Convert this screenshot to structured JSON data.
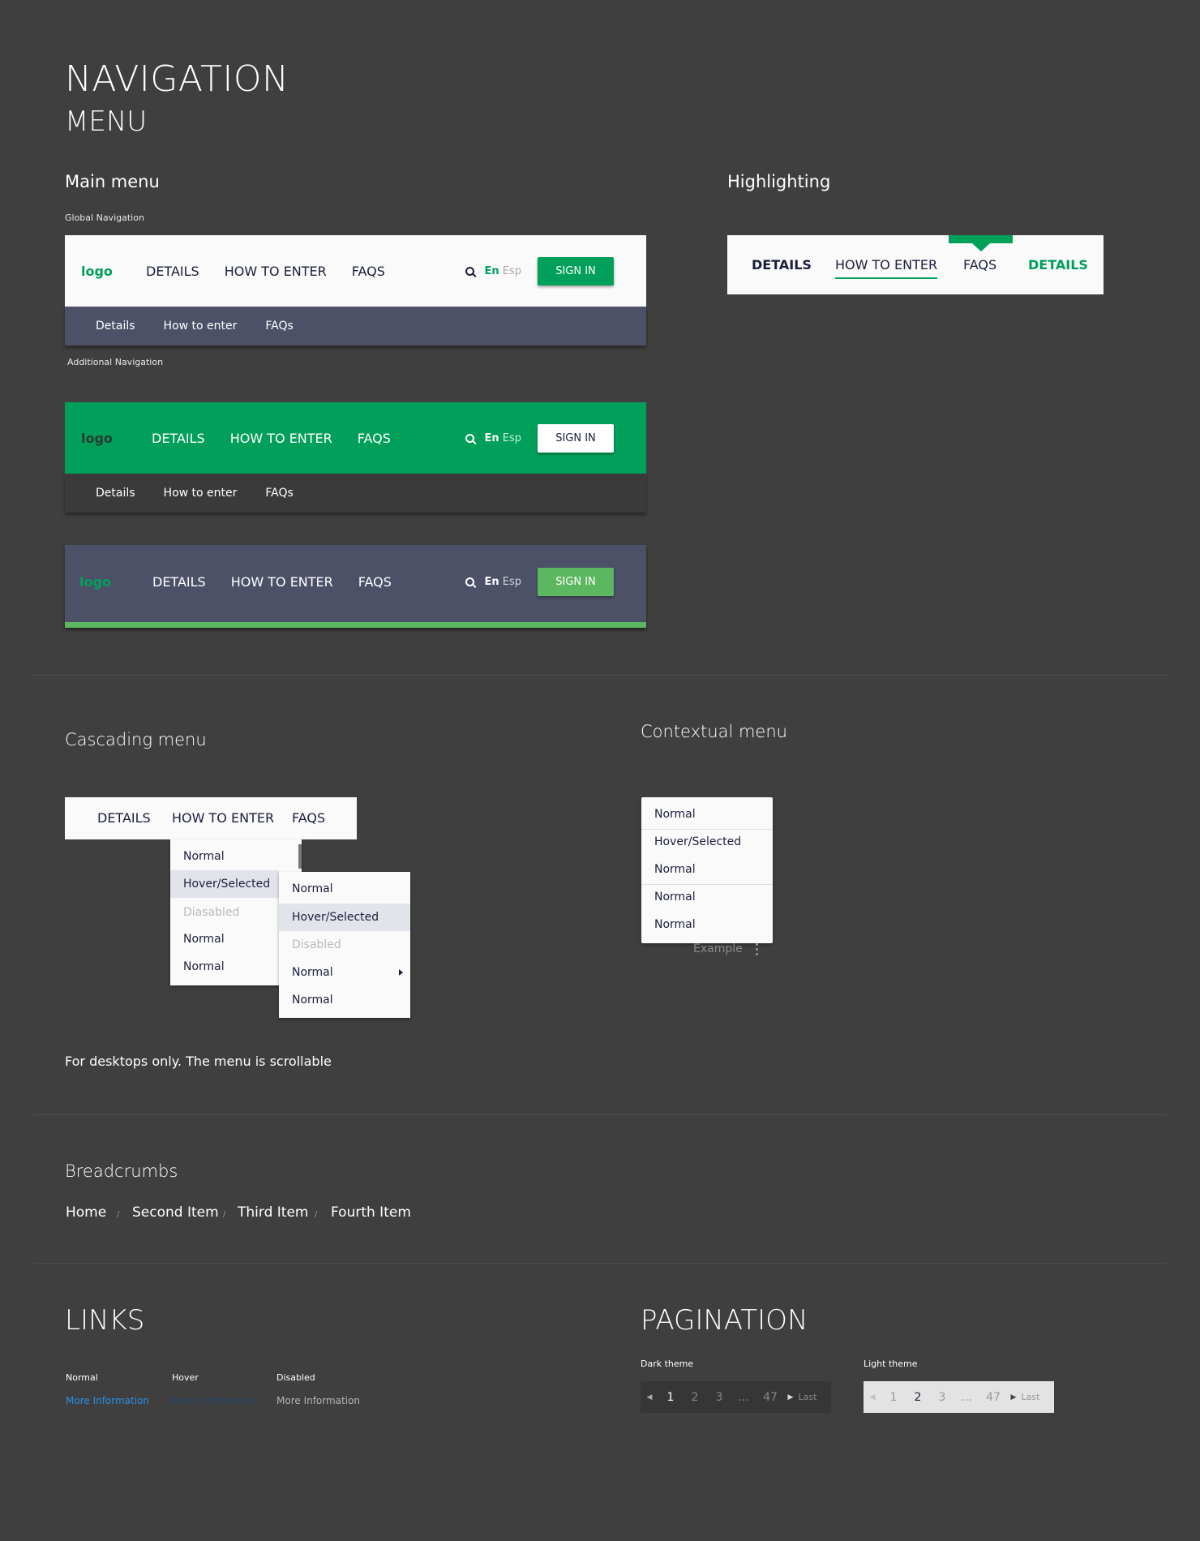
{
  "titles": {
    "navigation": "NAVIGATION",
    "menu": "MENU",
    "links": "LINKS",
    "pagination": "PAGINATION"
  },
  "sections": {
    "main_menu": "Main menu",
    "highlighting": "Highlighting",
    "cascading": "Cascading menu",
    "contextual": "Contextual menu",
    "breadcrumbs": "Breadcrumbs"
  },
  "captions": {
    "global": "Global Navigation",
    "additional": "Additional Navigation",
    "scroll_note": "For desktops only. The menu is scrollable"
  },
  "navbar": {
    "logo": "logo",
    "items": [
      "DETAILS",
      "HOW TO ENTER",
      "FAQS"
    ],
    "lang_en": "En",
    "lang_es": "Esp",
    "signin": "SIGN IN",
    "subitems": [
      "Details",
      "How to enter",
      "FAQs"
    ]
  },
  "highlight": {
    "items": [
      "DETAILS",
      "HOW TO ENTER",
      "FAQS",
      "DETAILS"
    ]
  },
  "cascading": {
    "bar": [
      "DETAILS",
      "HOW TO ENTER",
      "FAQS"
    ],
    "menu1": [
      "Normal",
      "Hover/Selected",
      "Diasabled",
      "Normal",
      "Normal"
    ],
    "menu2": [
      "Normal",
      "Hover/Selected",
      "Disabled",
      "Normal",
      "Normal"
    ]
  },
  "contextual": {
    "items": [
      "Normal",
      "Hover/Selected",
      "Normal",
      "Normal",
      "Normal"
    ],
    "example": "Example"
  },
  "breadcrumbs": {
    "items": [
      "Home",
      "Second Item",
      "Third Item",
      "Fourth Item"
    ],
    "separator": "/"
  },
  "links": {
    "labels": [
      "Normal",
      "Hover",
      "Disabled"
    ],
    "text": "More Information"
  },
  "pagination": {
    "dark_label": "Dark theme",
    "light_label": "Light theme",
    "pages": [
      "1",
      "2",
      "3",
      "...",
      "47"
    ],
    "last": "Last",
    "dark_current": "1",
    "light_current": "2"
  },
  "colors": {
    "background": "#3f3f3f",
    "green": "#00a05a",
    "slate": "#4d5168",
    "light_green": "#5cb860",
    "link_blue": "#2a8fe6"
  }
}
